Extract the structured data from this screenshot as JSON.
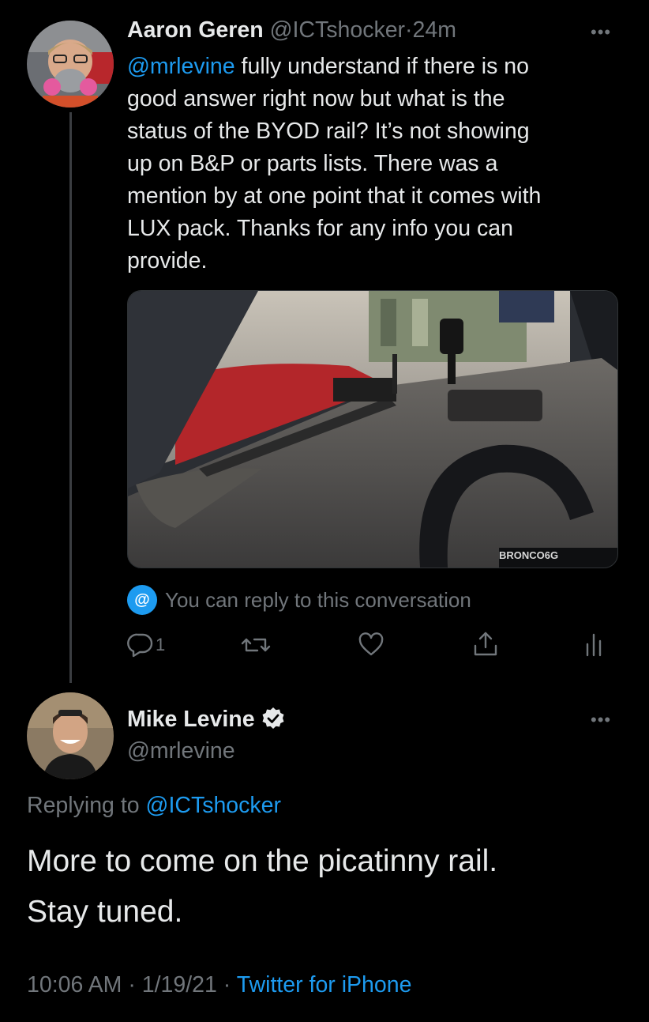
{
  "tweet1": {
    "author_name": "Aaron Geren",
    "author_handle": "@ICTshocker",
    "separator": "·",
    "time": "24m",
    "mention": "@mrlevine",
    "lines": [
      " fully understand if there is no",
      "good answer right now but what is the",
      "status of the BYOD rail? It’s not showing",
      "up on B&P or parts lists. There was a",
      "mention by at one point that it comes with",
      "LUX pack. Thanks for any info you can",
      "provide."
    ],
    "media_watermark": "BRONCO6G",
    "reply_prompt": "You can reply to this conversation",
    "reply_badge": "@",
    "reply_count": "1",
    "more_icon": "•••"
  },
  "tweet2": {
    "author_name": "Mike Levine",
    "author_handle": "@mrlevine",
    "verified_icon": "verified-badge-icon",
    "more_icon": "•••",
    "replying_prefix": "Replying to ",
    "replying_handle": "@ICTshocker",
    "text_lines": [
      "More to come on the picatinny rail.",
      "Stay tuned."
    ],
    "time": "10:06 AM",
    "date": "1/19/21",
    "separator": "·",
    "source": "Twitter for iPhone"
  },
  "colors": {
    "background": "#000000",
    "text": "#e7e9ea",
    "muted": "#71767b",
    "link": "#1d9bf0"
  }
}
